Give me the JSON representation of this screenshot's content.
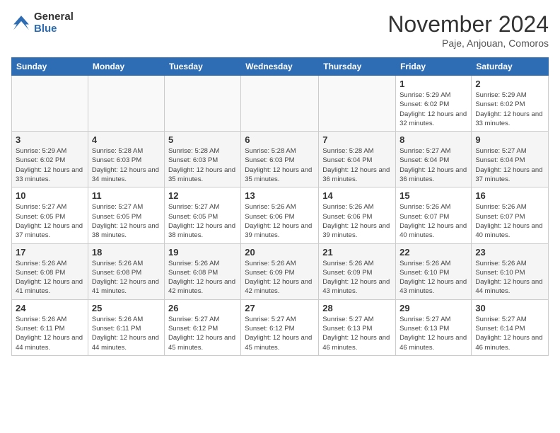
{
  "header": {
    "logo_general": "General",
    "logo_blue": "Blue",
    "month_title": "November 2024",
    "location": "Paje, Anjouan, Comoros"
  },
  "weekdays": [
    "Sunday",
    "Monday",
    "Tuesday",
    "Wednesday",
    "Thursday",
    "Friday",
    "Saturday"
  ],
  "weeks": [
    [
      {
        "day": "",
        "info": ""
      },
      {
        "day": "",
        "info": ""
      },
      {
        "day": "",
        "info": ""
      },
      {
        "day": "",
        "info": ""
      },
      {
        "day": "",
        "info": ""
      },
      {
        "day": "1",
        "info": "Sunrise: 5:29 AM\nSunset: 6:02 PM\nDaylight: 12 hours and 32 minutes."
      },
      {
        "day": "2",
        "info": "Sunrise: 5:29 AM\nSunset: 6:02 PM\nDaylight: 12 hours and 33 minutes."
      }
    ],
    [
      {
        "day": "3",
        "info": "Sunrise: 5:29 AM\nSunset: 6:02 PM\nDaylight: 12 hours and 33 minutes."
      },
      {
        "day": "4",
        "info": "Sunrise: 5:28 AM\nSunset: 6:03 PM\nDaylight: 12 hours and 34 minutes."
      },
      {
        "day": "5",
        "info": "Sunrise: 5:28 AM\nSunset: 6:03 PM\nDaylight: 12 hours and 35 minutes."
      },
      {
        "day": "6",
        "info": "Sunrise: 5:28 AM\nSunset: 6:03 PM\nDaylight: 12 hours and 35 minutes."
      },
      {
        "day": "7",
        "info": "Sunrise: 5:28 AM\nSunset: 6:04 PM\nDaylight: 12 hours and 36 minutes."
      },
      {
        "day": "8",
        "info": "Sunrise: 5:27 AM\nSunset: 6:04 PM\nDaylight: 12 hours and 36 minutes."
      },
      {
        "day": "9",
        "info": "Sunrise: 5:27 AM\nSunset: 6:04 PM\nDaylight: 12 hours and 37 minutes."
      }
    ],
    [
      {
        "day": "10",
        "info": "Sunrise: 5:27 AM\nSunset: 6:05 PM\nDaylight: 12 hours and 37 minutes."
      },
      {
        "day": "11",
        "info": "Sunrise: 5:27 AM\nSunset: 6:05 PM\nDaylight: 12 hours and 38 minutes."
      },
      {
        "day": "12",
        "info": "Sunrise: 5:27 AM\nSunset: 6:05 PM\nDaylight: 12 hours and 38 minutes."
      },
      {
        "day": "13",
        "info": "Sunrise: 5:26 AM\nSunset: 6:06 PM\nDaylight: 12 hours and 39 minutes."
      },
      {
        "day": "14",
        "info": "Sunrise: 5:26 AM\nSunset: 6:06 PM\nDaylight: 12 hours and 39 minutes."
      },
      {
        "day": "15",
        "info": "Sunrise: 5:26 AM\nSunset: 6:07 PM\nDaylight: 12 hours and 40 minutes."
      },
      {
        "day": "16",
        "info": "Sunrise: 5:26 AM\nSunset: 6:07 PM\nDaylight: 12 hours and 40 minutes."
      }
    ],
    [
      {
        "day": "17",
        "info": "Sunrise: 5:26 AM\nSunset: 6:08 PM\nDaylight: 12 hours and 41 minutes."
      },
      {
        "day": "18",
        "info": "Sunrise: 5:26 AM\nSunset: 6:08 PM\nDaylight: 12 hours and 41 minutes."
      },
      {
        "day": "19",
        "info": "Sunrise: 5:26 AM\nSunset: 6:08 PM\nDaylight: 12 hours and 42 minutes."
      },
      {
        "day": "20",
        "info": "Sunrise: 5:26 AM\nSunset: 6:09 PM\nDaylight: 12 hours and 42 minutes."
      },
      {
        "day": "21",
        "info": "Sunrise: 5:26 AM\nSunset: 6:09 PM\nDaylight: 12 hours and 43 minutes."
      },
      {
        "day": "22",
        "info": "Sunrise: 5:26 AM\nSunset: 6:10 PM\nDaylight: 12 hours and 43 minutes."
      },
      {
        "day": "23",
        "info": "Sunrise: 5:26 AM\nSunset: 6:10 PM\nDaylight: 12 hours and 44 minutes."
      }
    ],
    [
      {
        "day": "24",
        "info": "Sunrise: 5:26 AM\nSunset: 6:11 PM\nDaylight: 12 hours and 44 minutes."
      },
      {
        "day": "25",
        "info": "Sunrise: 5:26 AM\nSunset: 6:11 PM\nDaylight: 12 hours and 44 minutes."
      },
      {
        "day": "26",
        "info": "Sunrise: 5:27 AM\nSunset: 6:12 PM\nDaylight: 12 hours and 45 minutes."
      },
      {
        "day": "27",
        "info": "Sunrise: 5:27 AM\nSunset: 6:12 PM\nDaylight: 12 hours and 45 minutes."
      },
      {
        "day": "28",
        "info": "Sunrise: 5:27 AM\nSunset: 6:13 PM\nDaylight: 12 hours and 46 minutes."
      },
      {
        "day": "29",
        "info": "Sunrise: 5:27 AM\nSunset: 6:13 PM\nDaylight: 12 hours and 46 minutes."
      },
      {
        "day": "30",
        "info": "Sunrise: 5:27 AM\nSunset: 6:14 PM\nDaylight: 12 hours and 46 minutes."
      }
    ]
  ]
}
